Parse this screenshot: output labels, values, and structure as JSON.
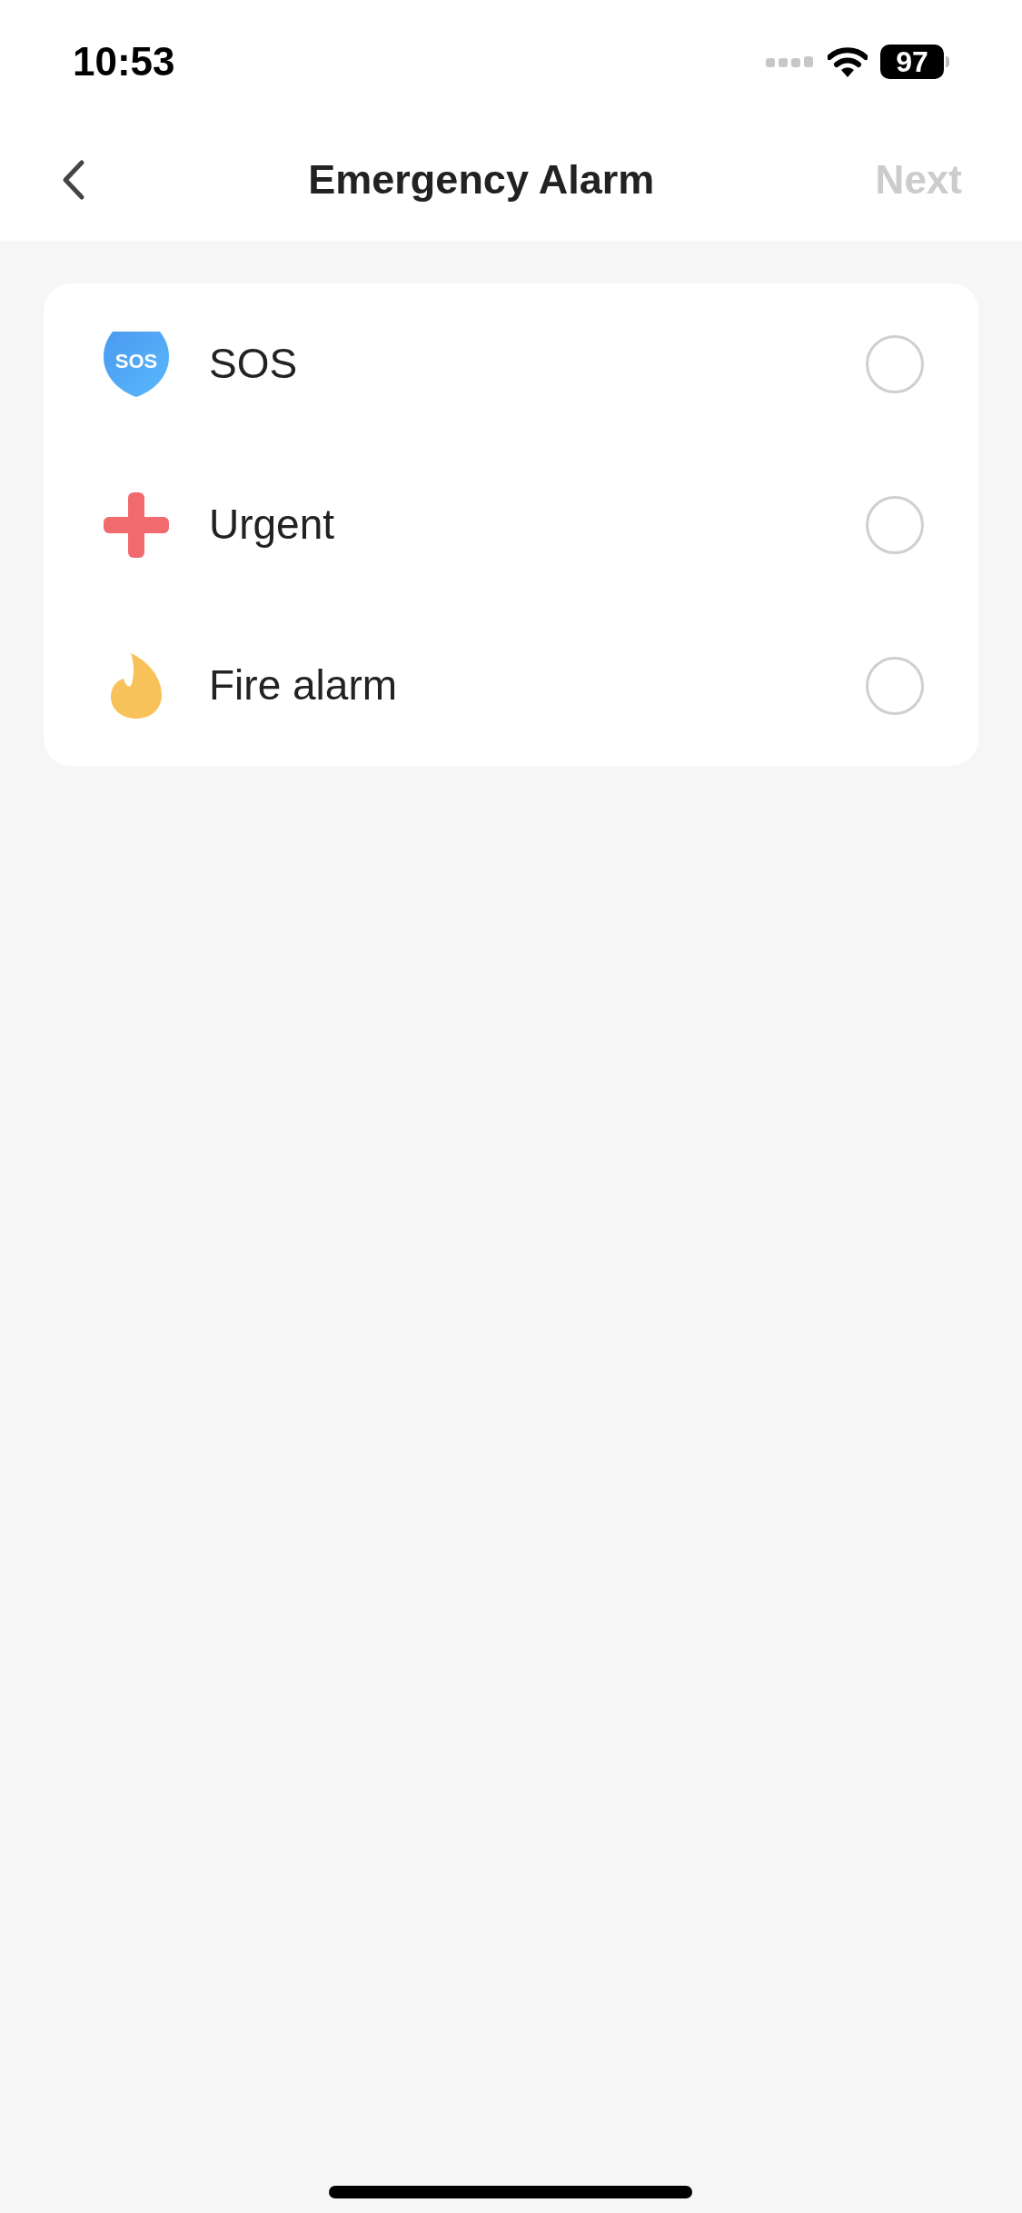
{
  "status_bar": {
    "time": "10:53",
    "battery": "97"
  },
  "nav": {
    "title": "Emergency Alarm",
    "next": "Next",
    "next_disabled": true
  },
  "options": [
    {
      "kind": "sos",
      "icon_text": "SOS",
      "label": "SOS",
      "selected": false
    },
    {
      "kind": "cross",
      "label": "Urgent",
      "selected": false
    },
    {
      "kind": "flame",
      "label": "Fire alarm",
      "selected": false
    }
  ]
}
